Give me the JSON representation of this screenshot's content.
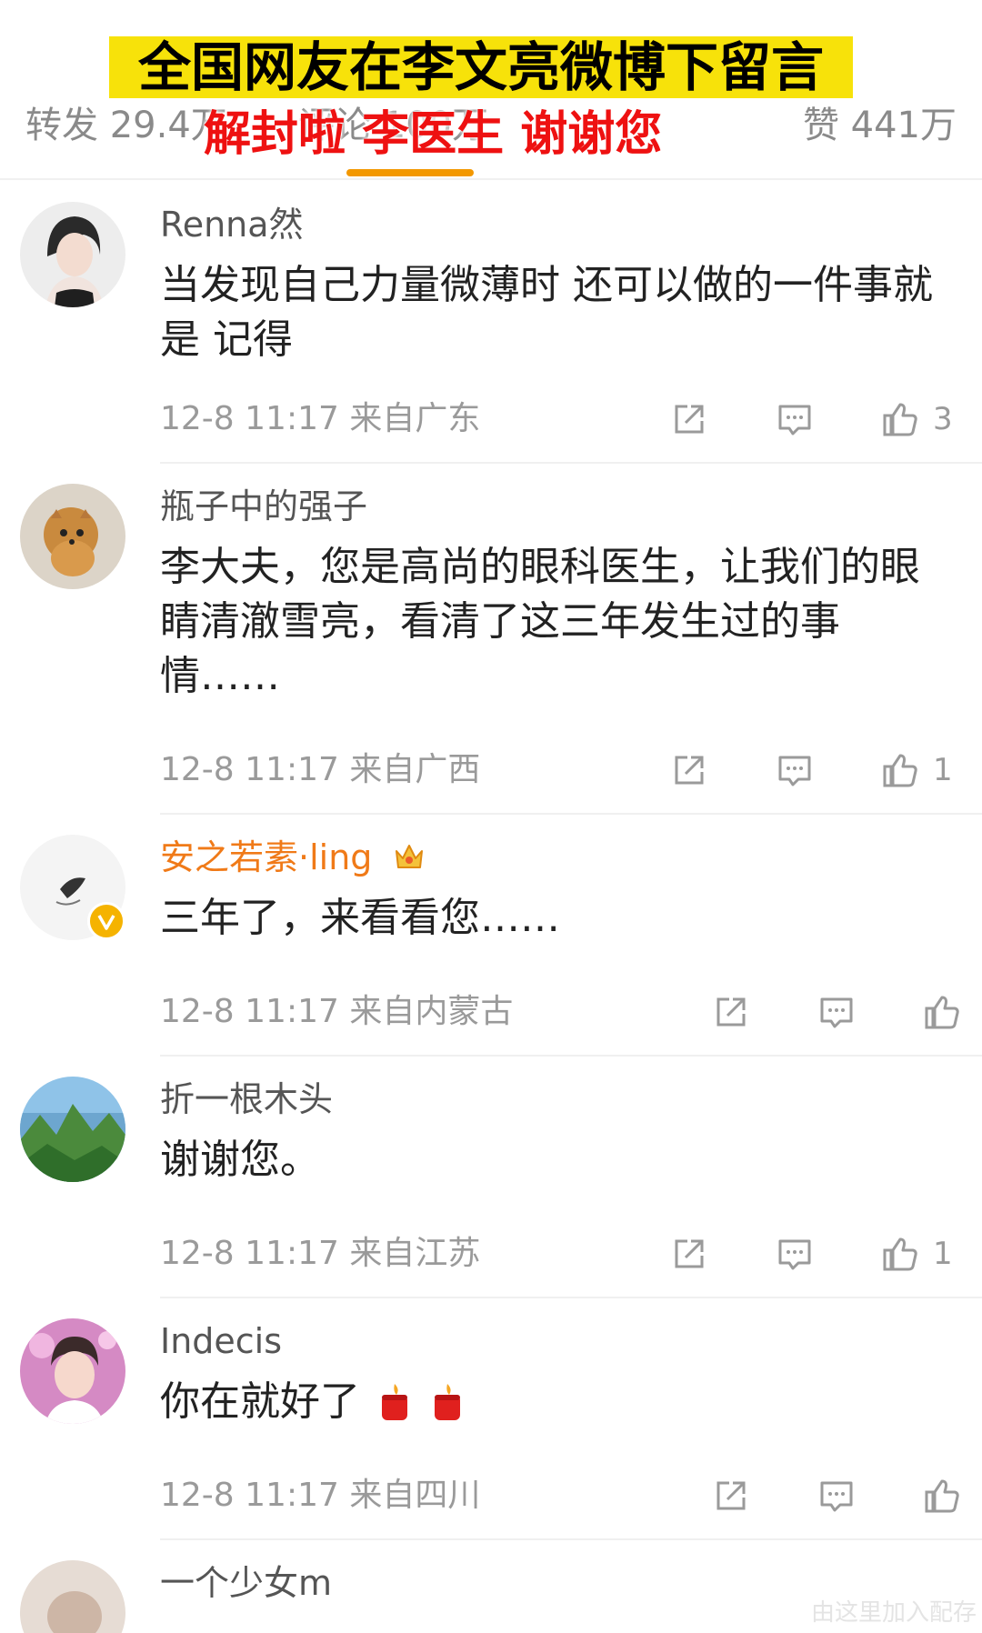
{
  "overlay": {
    "caption_top": "全国网友在李文亮微博下留言",
    "caption_bottom": "解封啦 李医生 谢谢您"
  },
  "stats": {
    "repost": "转发 29.4万",
    "comment": "评论 100万",
    "like": "赞 441万"
  },
  "comments": [
    {
      "username": "Renna然",
      "text": "当发现自己力量微薄时 还可以做的一件事就是 记得",
      "time": "12-8 11:17",
      "location": "来自广东",
      "likes": "3"
    },
    {
      "username": "瓶子中的强子",
      "text": "李大夫，您是高尚的眼科医生，让我们的眼睛清澈雪亮，看清了这三年发生过的事情……",
      "time": "12-8 11:17",
      "location": "来自广西",
      "likes": "1"
    },
    {
      "username": "安之若素·ling",
      "text": "三年了，来看看您……",
      "time": "12-8 11:17",
      "location": "来自内蒙古",
      "likes": ""
    },
    {
      "username": "折一根木头",
      "text": "谢谢您。",
      "time": "12-8 11:17",
      "location": "来自江苏",
      "likes": "1"
    },
    {
      "username": "Indecis",
      "text": "你在就好了",
      "time": "12-8 11:17",
      "location": "来自四川",
      "likes": ""
    },
    {
      "username": "一个少女m"
    }
  ],
  "icons": {
    "share": "share-icon",
    "comment": "comment-icon",
    "like": "thumbs-up-icon"
  },
  "colors": {
    "caption_bg": "#f7e20a",
    "caption_red": "#ee1111",
    "tab_underline": "#f39800",
    "vip_name": "#f07a18"
  },
  "watermark": "由这里加入配存"
}
